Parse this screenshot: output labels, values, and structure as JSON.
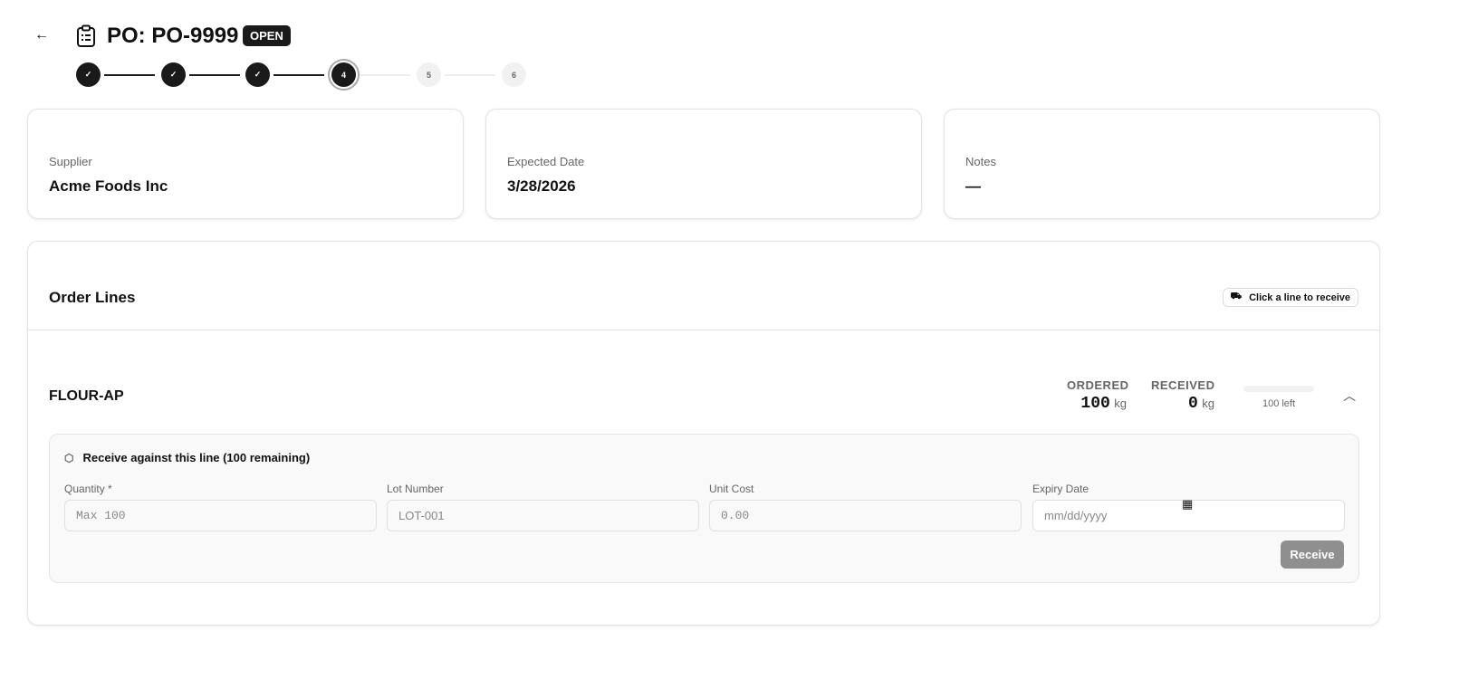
{
  "header": {
    "back_icon": "arrow-left-icon",
    "title": "PO: PO-9999",
    "status": "OPEN"
  },
  "stepper": {
    "steps": [
      "",
      "",
      "",
      "4",
      "5",
      "6"
    ],
    "completed": 3,
    "current": 4
  },
  "info": {
    "supplier": {
      "label": "Supplier",
      "value": "Acme Foods Inc"
    },
    "expected": {
      "label": "Expected Date",
      "value": "3/28/2026"
    },
    "notes": {
      "label": "Notes",
      "value": "—"
    }
  },
  "order_lines": {
    "title": "Order Lines",
    "hint": "Click a line to receive",
    "line": {
      "sku": "FLOUR-AP",
      "ordered_label": "ORDERED",
      "ordered": "100",
      "ordered_unit": "kg",
      "received_label": "RECEIVED",
      "received": "0",
      "received_unit": "kg",
      "progress_pct": 0,
      "left": "100 left"
    },
    "receive": {
      "title": "Receive against this line (100 remaining)",
      "quantity_label": "Quantity *",
      "quantity_placeholder": "Max 100",
      "lot_label": "Lot Number",
      "lot_placeholder": "LOT-001",
      "cost_label": "Unit Cost",
      "cost_placeholder": "0.00",
      "expiry_label": "Expiry Date",
      "expiry_placeholder": "mm/dd/yyyy",
      "button": "Receive"
    }
  }
}
